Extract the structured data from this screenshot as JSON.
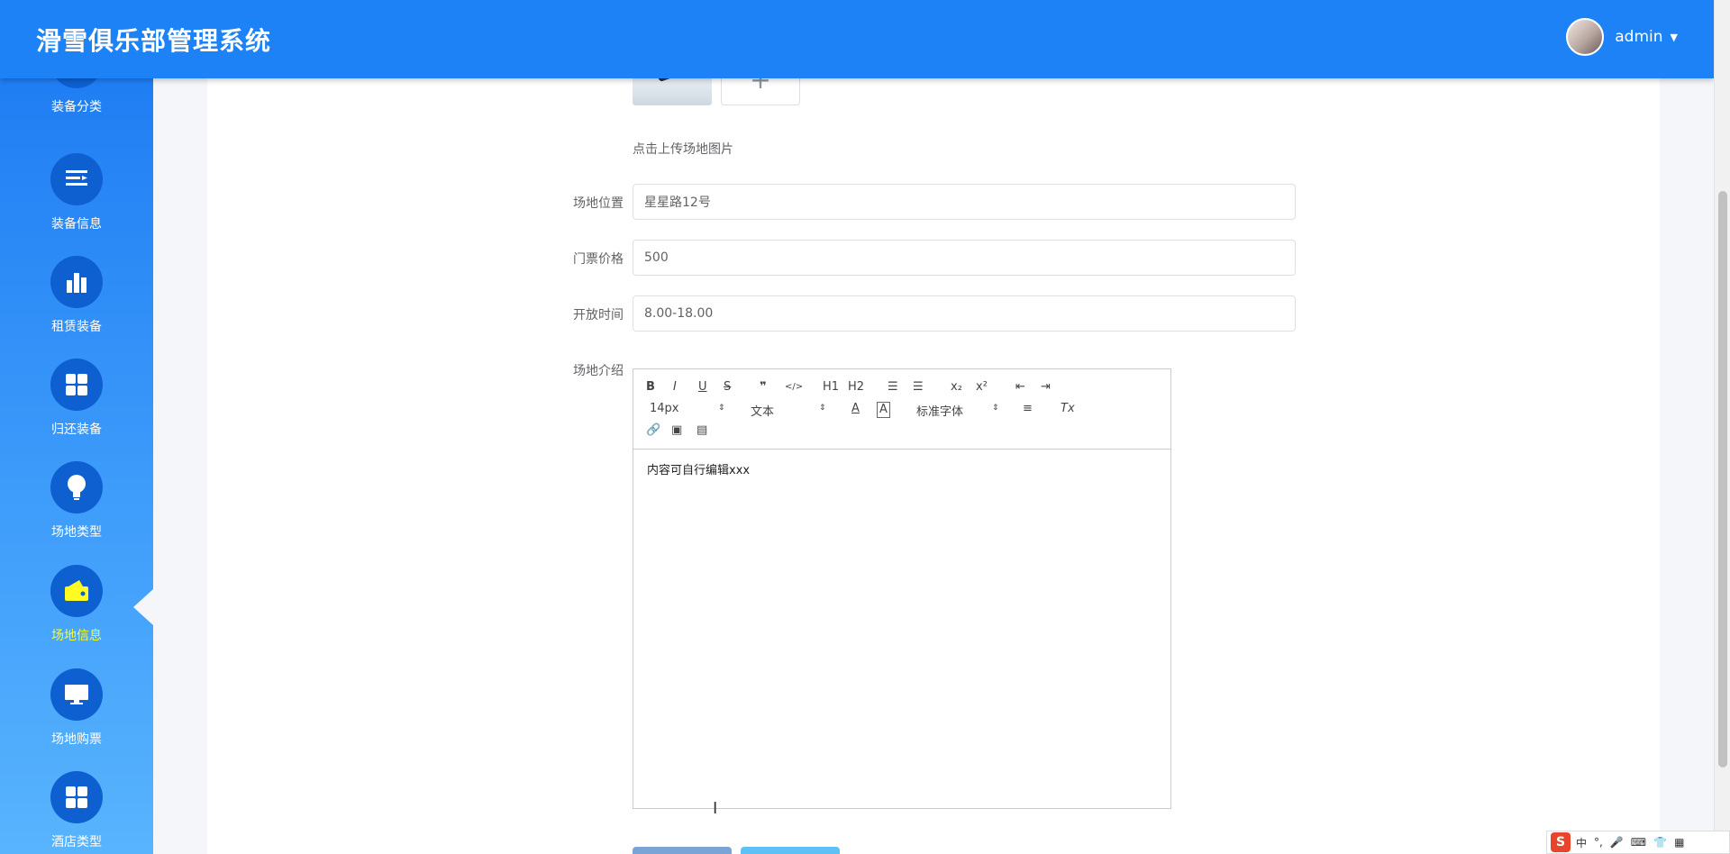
{
  "header": {
    "title": "滑雪俱乐部管理系统",
    "username": "admin"
  },
  "sidebar": {
    "items": [
      {
        "label": "装备分类",
        "icon": "category-icon"
      },
      {
        "label": "装备信息",
        "icon": "list-icon"
      },
      {
        "label": "租赁装备",
        "icon": "bar-chart-icon"
      },
      {
        "label": "归还装备",
        "icon": "grid-icon"
      },
      {
        "label": "场地类型",
        "icon": "lightbulb-icon"
      },
      {
        "label": "场地信息",
        "icon": "wallet-icon",
        "active": true
      },
      {
        "label": "场地购票",
        "icon": "monitor-icon"
      },
      {
        "label": "酒店类型",
        "icon": "grid-icon"
      }
    ]
  },
  "form": {
    "upload": {
      "plus": "+",
      "hint": "点击上传场地图片"
    },
    "location": {
      "label": "场地位置",
      "value": "星星路12号"
    },
    "price": {
      "label": "门票价格",
      "value": "500"
    },
    "hours": {
      "label": "开放时间",
      "value": "8.00-18.00"
    },
    "intro": {
      "label": "场地介绍",
      "content": "内容可自行编辑xxx"
    }
  },
  "editor": {
    "toolbar": {
      "bold": "B",
      "italic": "I",
      "underline": "U",
      "strike": "S",
      "quote": "❞",
      "code": "</>",
      "h1": "H1",
      "h2": "H2",
      "ordered_list": "☰",
      "bullet_list": "☰",
      "sub": "x₂",
      "sup": "x²",
      "size_value": "14px",
      "header_value": "文本",
      "font_value": "标准字体",
      "color": "A",
      "background": "A",
      "align": "≡",
      "clean": "Tx",
      "link": "🔗",
      "image": "▣",
      "video": "▤"
    }
  },
  "ime": {
    "logo": "S",
    "mode": "中",
    "punct": "°,",
    "voice": "🎤",
    "keyboard": "⌨"
  },
  "colors": {
    "primary": "#1e82f7",
    "active_label": "#fffb23"
  }
}
